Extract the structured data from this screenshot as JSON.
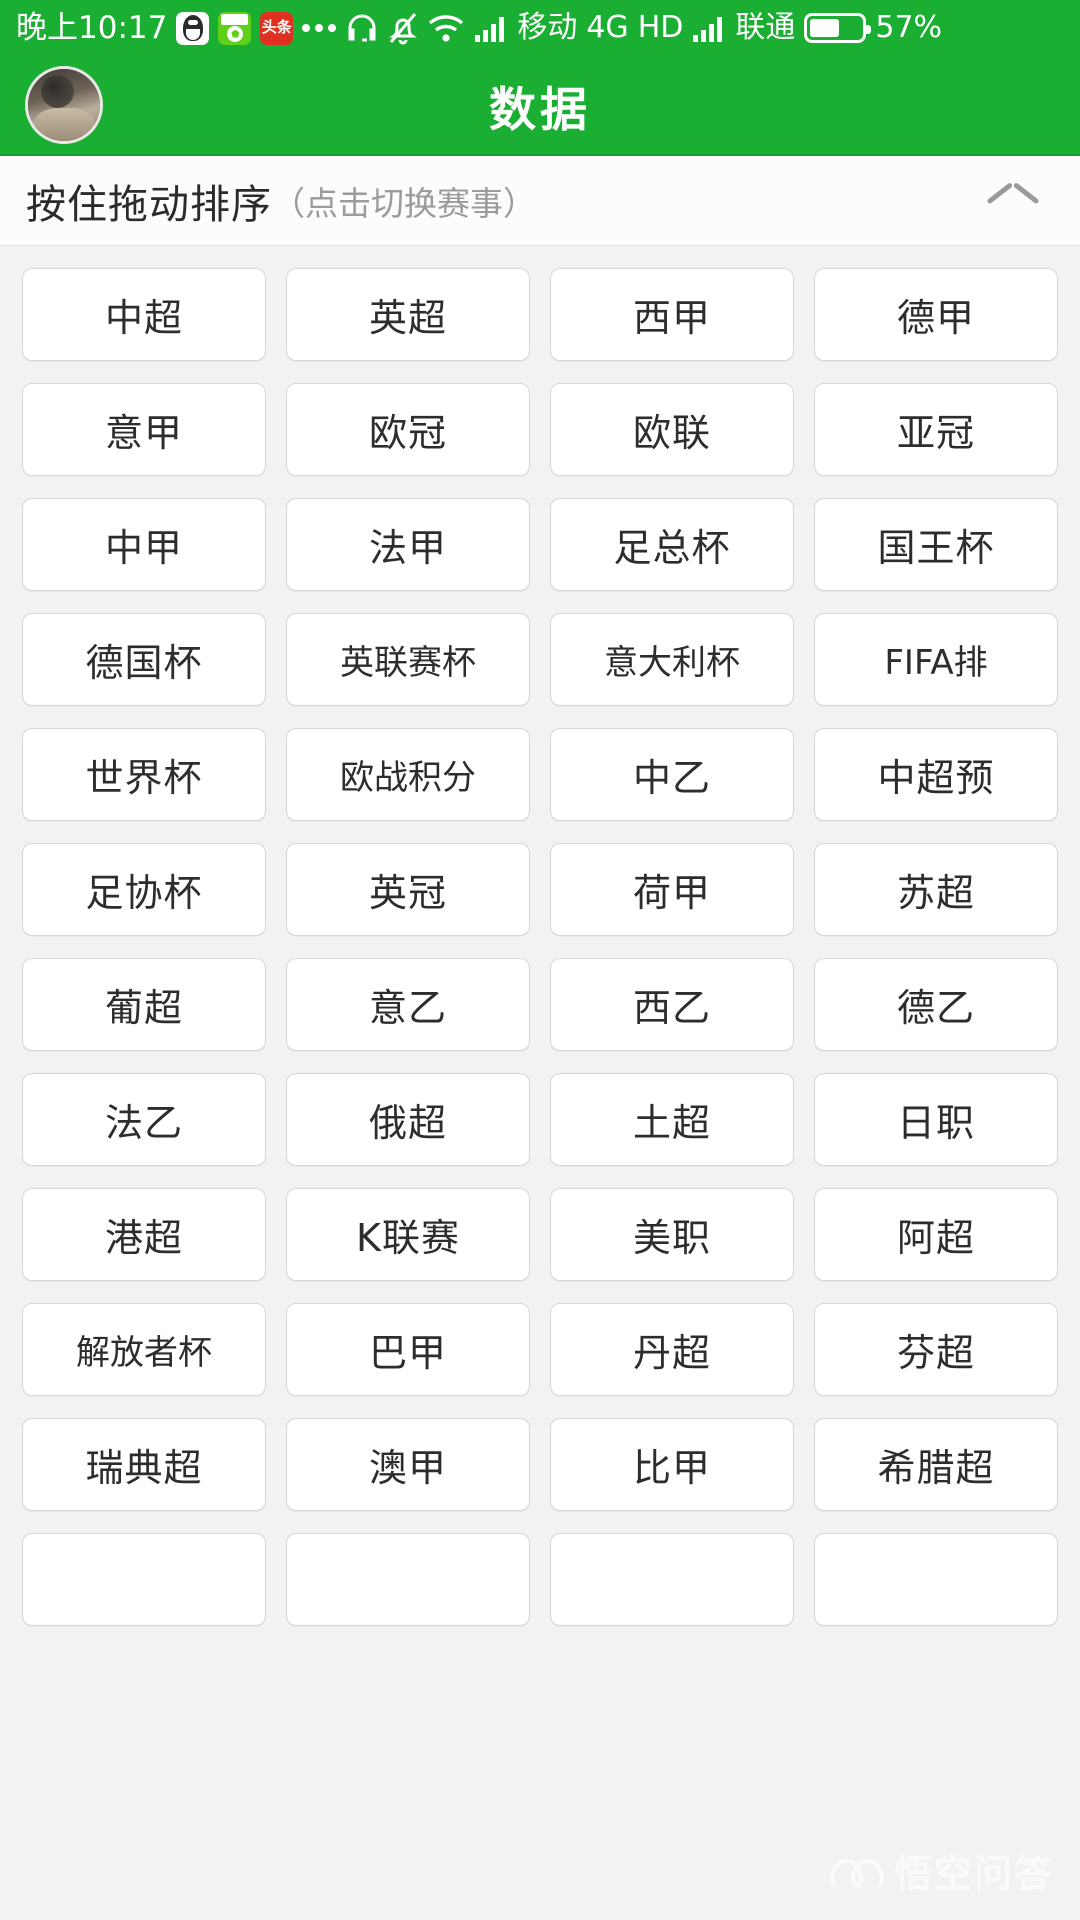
{
  "status_bar": {
    "time": "晚上10:17",
    "app_icons": [
      {
        "name": "qq-icon",
        "label": ""
      },
      {
        "name": "football-app-icon",
        "label": ""
      },
      {
        "name": "toutiao-icon",
        "label": "头条"
      }
    ],
    "overflow_dots": "...",
    "icons": [
      "headset-icon",
      "bell-muted-icon",
      "wifi-icon",
      "signal-bars-icon"
    ],
    "carrier_primary": "移动",
    "network_type": "4G",
    "hd_label": "HD",
    "carrier_secondary": "联通",
    "battery_percent": "57%",
    "battery_level": 57
  },
  "header": {
    "title": "数据",
    "avatar_alt": "用户头像"
  },
  "sort_bar": {
    "main_text": "按住拖动排序",
    "sub_text": "（点击切换赛事）",
    "collapse_icon": "chevron-up-icon"
  },
  "grid": {
    "columns": 4,
    "items": [
      "中超",
      "英超",
      "西甲",
      "德甲",
      "意甲",
      "欧冠",
      "欧联",
      "亚冠",
      "中甲",
      "法甲",
      "足总杯",
      "国王杯",
      "德国杯",
      "英联赛杯",
      "意大利杯",
      "FIFA排",
      "世界杯",
      "欧战积分",
      "中乙",
      "中超预",
      "足协杯",
      "英冠",
      "荷甲",
      "苏超",
      "葡超",
      "意乙",
      "西乙",
      "德乙",
      "法乙",
      "俄超",
      "土超",
      "日职",
      "港超",
      "K联赛",
      "美职",
      "阿超",
      "解放者杯",
      "巴甲",
      "丹超",
      "芬超",
      "瑞典超",
      "澳甲",
      "比甲",
      "希腊超",
      "",
      "",
      "",
      ""
    ]
  },
  "watermark": {
    "text": "悟空问答",
    "logo": "wukong-logo-icon"
  },
  "colors": {
    "brand_green": "#1aaf33",
    "page_background": "#f2f2f2",
    "chip_background": "#ffffff",
    "chip_border": "#d6d6d6",
    "text_primary": "#2d2d2d",
    "text_muted": "#9b9b9b"
  }
}
